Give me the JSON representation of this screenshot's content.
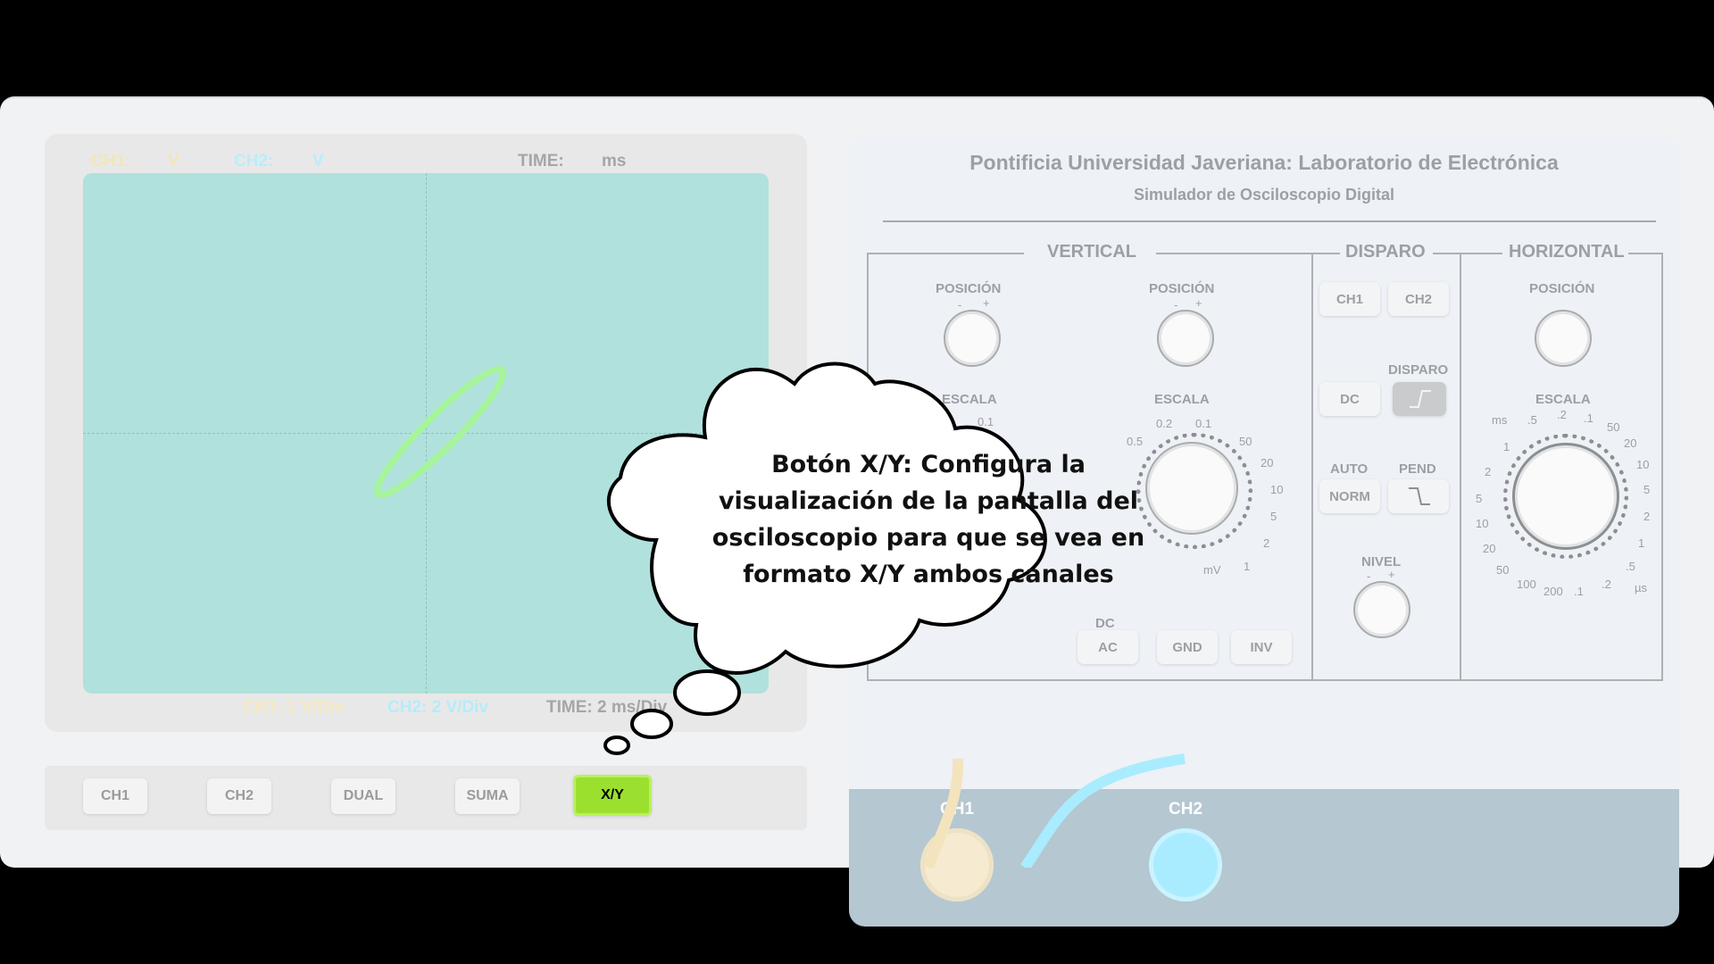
{
  "screen": {
    "top_ch1_label": "CH1:",
    "top_ch1_unit": "V",
    "top_ch2_label": "CH2:",
    "top_ch2_unit": "V",
    "top_time_label": "TIME:",
    "top_time_unit": "ms",
    "bottom_ch1": "CH1: 1 V/Div",
    "bottom_ch2": "CH2: 2 V/Div",
    "bottom_time": "TIME: 2 ms/Div",
    "colors": {
      "screen_bg": "#b0e1dc",
      "trace": "#a6f59a",
      "ch1": "#f6e6b8",
      "ch2": "#a9ecff"
    }
  },
  "mode_buttons": [
    {
      "label": "CH1",
      "active": false
    },
    {
      "label": "CH2",
      "active": false
    },
    {
      "label": "DUAL",
      "active": false
    },
    {
      "label": "SUMA",
      "active": false
    },
    {
      "label": "X/Y",
      "active": true
    }
  ],
  "panel": {
    "title": "Pontificia Universidad Javeriana: Laboratorio de Electrónica",
    "subtitle": "Simulador de Osciloscopio Digital",
    "vertical": {
      "title": "VERTICAL",
      "position_label": "POSICIÓN",
      "minus": "-",
      "plus": "+",
      "scale_label": "ESCALA",
      "ch1_scale_partial": "ESCALA",
      "ch1_scale_tick": "0.1",
      "ch2_scale_ticks": [
        "0.5",
        "0.2",
        "0.1",
        "50",
        "20",
        "10",
        "5",
        "2",
        "1",
        "mV"
      ],
      "coupling_partial": "DC",
      "coupling_buttons": [
        "AC",
        "GND",
        "INV"
      ]
    },
    "trigger": {
      "title": "DISPARO",
      "ch1": "CH1",
      "ch2": "CH2",
      "dc": "DC",
      "disparo_label": "DISPARO",
      "auto_label": "AUTO",
      "pend_label": "PEND",
      "norm": "NORM",
      "level_label": "NIVEL",
      "minus": "-",
      "plus": "+"
    },
    "horizontal": {
      "title": "HORIZONTAL",
      "position_label": "POSICIÓN",
      "scale_label": "ESCALA",
      "ticks": [
        "ms",
        ".5",
        ".2",
        ".1",
        "50",
        "20",
        "10",
        "5",
        "2",
        "1",
        ".5",
        ".2",
        ".1",
        "200",
        "100",
        "50",
        "20",
        "10",
        "5",
        "2",
        "1",
        "µs"
      ]
    }
  },
  "connectors": {
    "ch1": "CH1",
    "ch2": "CH2"
  },
  "tooltip": {
    "lines": [
      "Botón X/Y: Configura la",
      "visualización de la pantalla del",
      "osciloscopio para que se vea en",
      "formato X/Y ambos canales"
    ]
  }
}
